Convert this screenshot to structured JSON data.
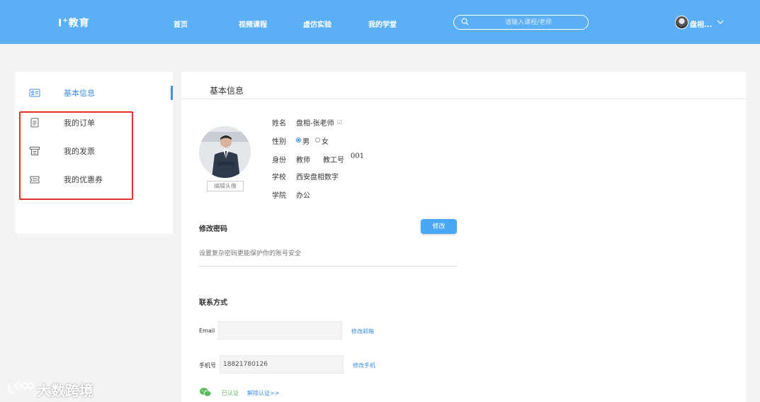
{
  "brand": {
    "logo": "I⁺教育",
    "logo_main": "I",
    "logo_sup": "+",
    "logo_text": "教育"
  },
  "nav": {
    "items": [
      {
        "label": "首页"
      },
      {
        "label": "视频课程"
      },
      {
        "label": "虚仿实验"
      },
      {
        "label": "我的学堂"
      }
    ]
  },
  "search": {
    "placeholder": "请输入课程/老师"
  },
  "user": {
    "name": "盘相..."
  },
  "sidebar": {
    "items": [
      {
        "label": "基本信息",
        "icon": "id-card-icon"
      },
      {
        "label": "我的订单",
        "icon": "order-document-icon"
      },
      {
        "label": "我的发票",
        "icon": "invoice-icon"
      },
      {
        "label": "我的优惠券",
        "icon": "coupon-icon"
      }
    ]
  },
  "main": {
    "title": "基本信息",
    "edit_avatar": "编辑头像",
    "profile": {
      "name_label": "姓名",
      "name_value": "盘相-张老师",
      "gender_label": "性别",
      "gender_male": "男",
      "gender_female": "女",
      "gender_selected": "男",
      "identity_label": "身份",
      "identity_value": "教师",
      "employee_id_label": "教工号",
      "employee_id_value": "001",
      "school_label": "学校",
      "school_value": "西安盘相数字",
      "college_label": "学院",
      "college_value": "办公"
    },
    "password": {
      "title": "修改密码",
      "button": "修改",
      "hint": "设置复杂密码更能保护你的账号安全"
    },
    "contact": {
      "title": "联系方式",
      "email_label": "Email",
      "email_value": "",
      "email_link": "修改邮箱",
      "phone_label": "手机号",
      "phone_value": "18821780126",
      "phone_link": "修改手机",
      "wechat_status": "已认证",
      "wechat_unbind": "解除认证>>"
    }
  },
  "watermark": {
    "text": "大数跨境"
  },
  "colors": {
    "header": "#5aaff5",
    "accent": "#3f8fe0",
    "highlight_box": "#e0322b",
    "verified": "#5cb85c"
  }
}
